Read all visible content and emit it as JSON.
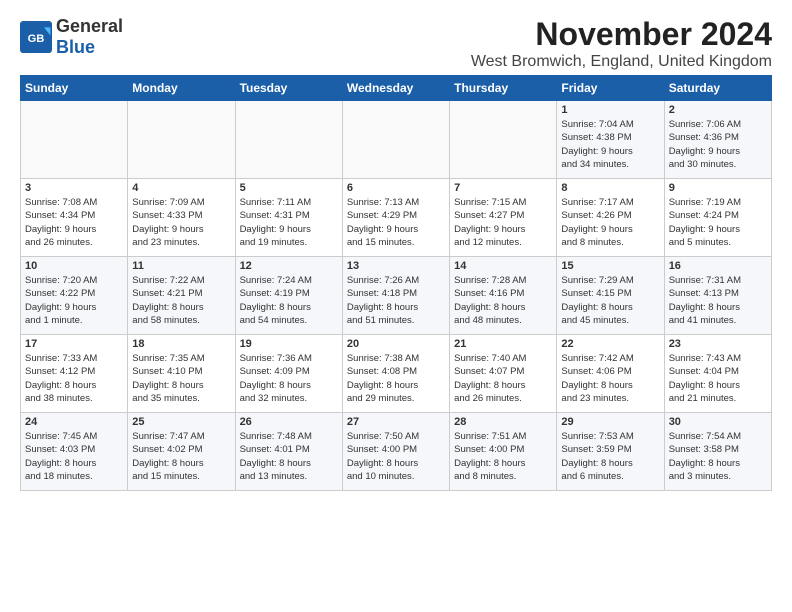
{
  "header": {
    "logo_general": "General",
    "logo_blue": "Blue",
    "month": "November 2024",
    "location": "West Bromwich, England, United Kingdom"
  },
  "weekdays": [
    "Sunday",
    "Monday",
    "Tuesday",
    "Wednesday",
    "Thursday",
    "Friday",
    "Saturday"
  ],
  "weeks": [
    [
      {
        "day": "",
        "info": ""
      },
      {
        "day": "",
        "info": ""
      },
      {
        "day": "",
        "info": ""
      },
      {
        "day": "",
        "info": ""
      },
      {
        "day": "",
        "info": ""
      },
      {
        "day": "1",
        "info": "Sunrise: 7:04 AM\nSunset: 4:38 PM\nDaylight: 9 hours\nand 34 minutes."
      },
      {
        "day": "2",
        "info": "Sunrise: 7:06 AM\nSunset: 4:36 PM\nDaylight: 9 hours\nand 30 minutes."
      }
    ],
    [
      {
        "day": "3",
        "info": "Sunrise: 7:08 AM\nSunset: 4:34 PM\nDaylight: 9 hours\nand 26 minutes."
      },
      {
        "day": "4",
        "info": "Sunrise: 7:09 AM\nSunset: 4:33 PM\nDaylight: 9 hours\nand 23 minutes."
      },
      {
        "day": "5",
        "info": "Sunrise: 7:11 AM\nSunset: 4:31 PM\nDaylight: 9 hours\nand 19 minutes."
      },
      {
        "day": "6",
        "info": "Sunrise: 7:13 AM\nSunset: 4:29 PM\nDaylight: 9 hours\nand 15 minutes."
      },
      {
        "day": "7",
        "info": "Sunrise: 7:15 AM\nSunset: 4:27 PM\nDaylight: 9 hours\nand 12 minutes."
      },
      {
        "day": "8",
        "info": "Sunrise: 7:17 AM\nSunset: 4:26 PM\nDaylight: 9 hours\nand 8 minutes."
      },
      {
        "day": "9",
        "info": "Sunrise: 7:19 AM\nSunset: 4:24 PM\nDaylight: 9 hours\nand 5 minutes."
      }
    ],
    [
      {
        "day": "10",
        "info": "Sunrise: 7:20 AM\nSunset: 4:22 PM\nDaylight: 9 hours\nand 1 minute."
      },
      {
        "day": "11",
        "info": "Sunrise: 7:22 AM\nSunset: 4:21 PM\nDaylight: 8 hours\nand 58 minutes."
      },
      {
        "day": "12",
        "info": "Sunrise: 7:24 AM\nSunset: 4:19 PM\nDaylight: 8 hours\nand 54 minutes."
      },
      {
        "day": "13",
        "info": "Sunrise: 7:26 AM\nSunset: 4:18 PM\nDaylight: 8 hours\nand 51 minutes."
      },
      {
        "day": "14",
        "info": "Sunrise: 7:28 AM\nSunset: 4:16 PM\nDaylight: 8 hours\nand 48 minutes."
      },
      {
        "day": "15",
        "info": "Sunrise: 7:29 AM\nSunset: 4:15 PM\nDaylight: 8 hours\nand 45 minutes."
      },
      {
        "day": "16",
        "info": "Sunrise: 7:31 AM\nSunset: 4:13 PM\nDaylight: 8 hours\nand 41 minutes."
      }
    ],
    [
      {
        "day": "17",
        "info": "Sunrise: 7:33 AM\nSunset: 4:12 PM\nDaylight: 8 hours\nand 38 minutes."
      },
      {
        "day": "18",
        "info": "Sunrise: 7:35 AM\nSunset: 4:10 PM\nDaylight: 8 hours\nand 35 minutes."
      },
      {
        "day": "19",
        "info": "Sunrise: 7:36 AM\nSunset: 4:09 PM\nDaylight: 8 hours\nand 32 minutes."
      },
      {
        "day": "20",
        "info": "Sunrise: 7:38 AM\nSunset: 4:08 PM\nDaylight: 8 hours\nand 29 minutes."
      },
      {
        "day": "21",
        "info": "Sunrise: 7:40 AM\nSunset: 4:07 PM\nDaylight: 8 hours\nand 26 minutes."
      },
      {
        "day": "22",
        "info": "Sunrise: 7:42 AM\nSunset: 4:06 PM\nDaylight: 8 hours\nand 23 minutes."
      },
      {
        "day": "23",
        "info": "Sunrise: 7:43 AM\nSunset: 4:04 PM\nDaylight: 8 hours\nand 21 minutes."
      }
    ],
    [
      {
        "day": "24",
        "info": "Sunrise: 7:45 AM\nSunset: 4:03 PM\nDaylight: 8 hours\nand 18 minutes."
      },
      {
        "day": "25",
        "info": "Sunrise: 7:47 AM\nSunset: 4:02 PM\nDaylight: 8 hours\nand 15 minutes."
      },
      {
        "day": "26",
        "info": "Sunrise: 7:48 AM\nSunset: 4:01 PM\nDaylight: 8 hours\nand 13 minutes."
      },
      {
        "day": "27",
        "info": "Sunrise: 7:50 AM\nSunset: 4:00 PM\nDaylight: 8 hours\nand 10 minutes."
      },
      {
        "day": "28",
        "info": "Sunrise: 7:51 AM\nSunset: 4:00 PM\nDaylight: 8 hours\nand 8 minutes."
      },
      {
        "day": "29",
        "info": "Sunrise: 7:53 AM\nSunset: 3:59 PM\nDaylight: 8 hours\nand 6 minutes."
      },
      {
        "day": "30",
        "info": "Sunrise: 7:54 AM\nSunset: 3:58 PM\nDaylight: 8 hours\nand 3 minutes."
      }
    ]
  ]
}
